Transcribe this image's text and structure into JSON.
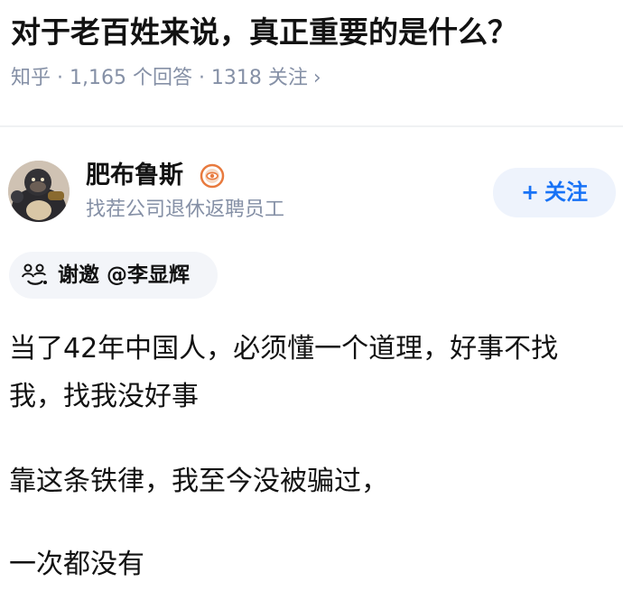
{
  "question": {
    "title": "对于老百姓来说，真正重要的是什么？",
    "meta": "知乎 · 1,165 个回答 · 1318 关注",
    "chevron": "›"
  },
  "author": {
    "name": "肥布鲁斯",
    "headline": "找茬公司退休返聘员工",
    "badge_icon": "eye-badge-icon",
    "follow_label": "关注",
    "follow_plus": "+"
  },
  "invite": {
    "icon": "invite-icon",
    "text": "谢邀 @李显辉"
  },
  "answer": {
    "paragraphs": [
      "当了42年中国人，必须懂一个道理，好事不找",
      "我，找我没好事",
      "靠这条铁律，我至今没被骗过，",
      "一次都没有"
    ]
  },
  "colors": {
    "accent": "#1772f6",
    "follow_bg": "#eef3fc",
    "meta_text": "#8590a6",
    "badge": "#e87a3e"
  }
}
